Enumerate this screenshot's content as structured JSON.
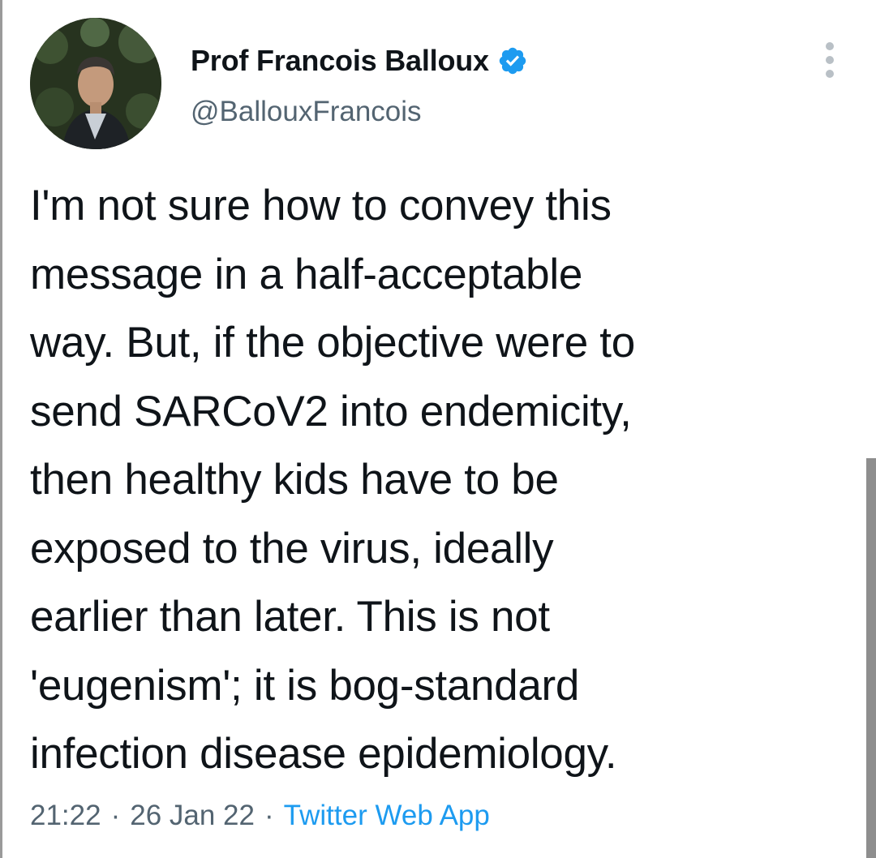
{
  "author": {
    "display_name": "Prof Francois Balloux",
    "handle": "@BallouxFrancois",
    "verified": true,
    "avatar_icon": "profile-photo"
  },
  "tweet": {
    "text": "I'm not sure how to convey this\nmessage in a half-acceptable\nway. But, if the objective were to\nsend SARCoV2 into endemicity,\nthen healthy kids have to be\nexposed to the virus, ideally\nearlier than later. This is not\n'eugenism'; it is bog-standard\ninfection disease epidemiology.",
    "time": "21:22",
    "separator": "·",
    "date": "26 Jan 22",
    "source": "Twitter Web App"
  },
  "icons": {
    "more": "more-options-icon",
    "verified": "verified-badge-icon"
  },
  "colors": {
    "accent": "#1d9bf0",
    "text": "#0f1419",
    "secondary": "#536471"
  }
}
